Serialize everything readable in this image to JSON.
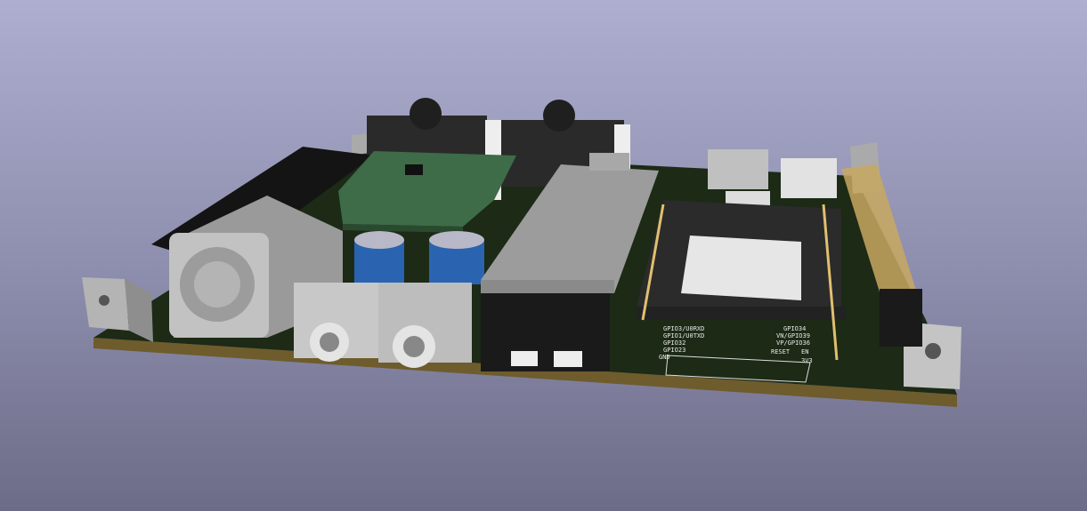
{
  "viewer": {
    "subject": "PCB 3D view"
  },
  "silkscreen": {
    "left_header": [
      "GPIO3/U0RXD",
      "GPIO1/U0TXD",
      "GPIO32",
      "GPIO23",
      "GND"
    ],
    "right_header": [
      "GPIO34",
      "VN/GPIO39",
      "VP/GPIO36",
      "EN",
      "RESET",
      "3V3"
    ]
  },
  "colors": {
    "board": "#1c2a16",
    "edge": "#6e5c2c",
    "module_green": "#3e6b48",
    "capacitor": "#2a64b0",
    "metal": "#bdbdbd",
    "pin": "#e0c070"
  }
}
